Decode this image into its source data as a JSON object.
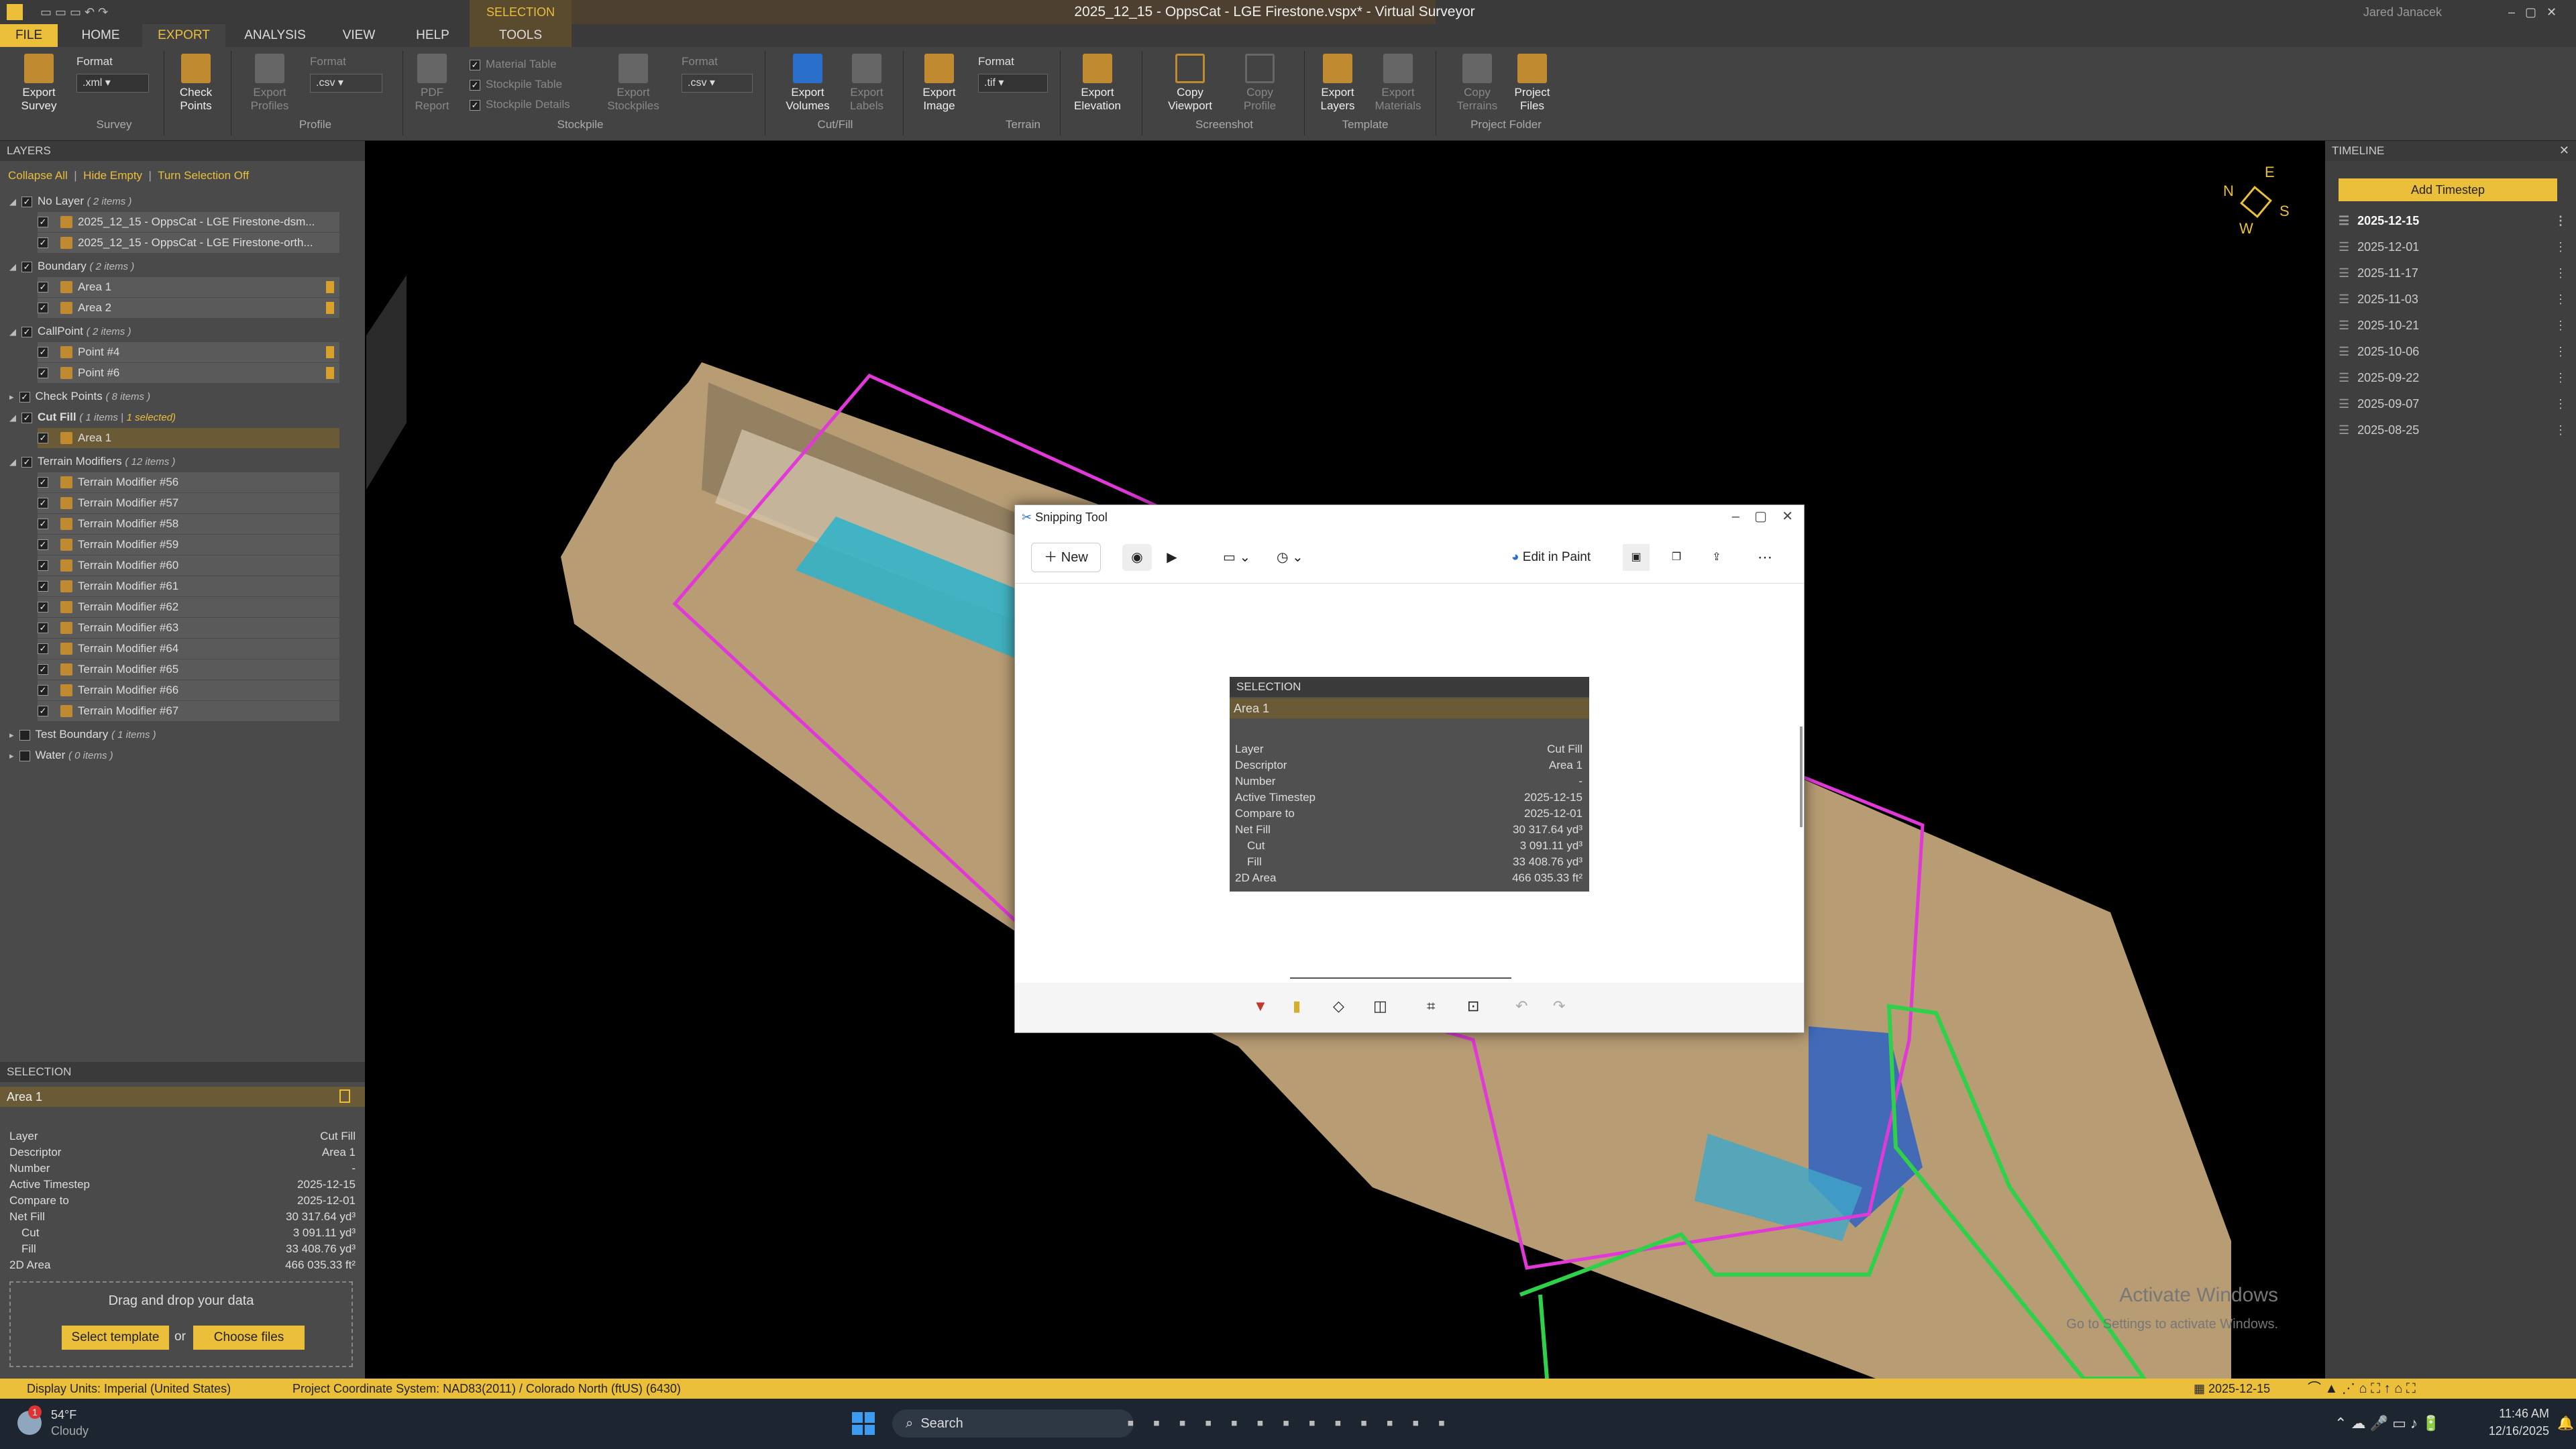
{
  "app": {
    "title": "2025_12_15 - OppsCat - LGE Firestone.vspx* - Virtual Surveyor",
    "user": "Jared Janacek",
    "context_tab_group": "SELECTION"
  },
  "tabs": [
    "FILE",
    "HOME",
    "EXPORT",
    "ANALYSIS",
    "VIEW",
    "HELP",
    "TOOLS"
  ],
  "ribbon": {
    "survey": {
      "export_survey": "Export\nSurvey",
      "format_label": "Format",
      "format_value": ".xml",
      "group": "Survey"
    },
    "check_points": "Check\nPoints",
    "profile": {
      "export_profiles": "Export\nProfiles",
      "format_label": "Format",
      "format_value": ".csv",
      "group": "Profile"
    },
    "stockpile": {
      "pdf_report": "PDF\nReport",
      "material_table": "Material Table",
      "stockpile_table": "Stockpile Table",
      "stockpile_details": "Stockpile Details",
      "export_stockpiles": "Export\nStockpiles",
      "format_label": "Format",
      "format_value": ".csv",
      "group": "Stockpile"
    },
    "cutfill": {
      "export_volumes": "Export\nVolumes",
      "export_labels": "Export\nLabels",
      "group": "Cut/Fill"
    },
    "terrain": {
      "export_image": "Export\nImage",
      "format_label": "Format",
      "format_value": ".tif",
      "export_elevation": "Export\nElevation",
      "group": "Terrain"
    },
    "screenshot": {
      "copy_viewport": "Copy\nViewport",
      "copy_profile": "Copy\nProfile",
      "group": "Screenshot"
    },
    "template": {
      "export_layers": "Export\nLayers",
      "export_materials": "Export\nMaterials",
      "group": "Template"
    },
    "project_folder": {
      "copy_terrains": "Copy\nTerrains",
      "project_files": "Project\nFiles",
      "group": "Project Folder"
    }
  },
  "layers": {
    "header": "LAYERS",
    "actions": [
      "Collapse All",
      "Hide Empty",
      "Turn Selection Off"
    ],
    "groups": [
      {
        "name": "No Layer",
        "count": "( 2 items )",
        "items": [
          "2025_12_15 - OppsCat - LGE Firestone-dsm...",
          "2025_12_15 - OppsCat - LGE Firestone-orth..."
        ]
      },
      {
        "name": "Boundary",
        "count": "( 2 items )",
        "items": [
          "Area 1",
          "Area 2"
        ]
      },
      {
        "name": "CallPoint",
        "count": "( 2 items )",
        "items": [
          "Point #4",
          "Point #6"
        ]
      },
      {
        "name": "Check Points",
        "count": "( 8 items )",
        "items": []
      },
      {
        "name": "Cut Fill",
        "count": "( 1 items |",
        "extra": "1 selected)",
        "items": [
          "Area 1"
        ]
      },
      {
        "name": "Terrain Modifiers",
        "count": "( 12 items )",
        "items": [
          "Terrain Modifier #56",
          "Terrain Modifier #57",
          "Terrain Modifier #58",
          "Terrain Modifier #59",
          "Terrain Modifier #60",
          "Terrain Modifier #61",
          "Terrain Modifier #62",
          "Terrain Modifier #63",
          "Terrain Modifier #64",
          "Terrain Modifier #65",
          "Terrain Modifier #66",
          "Terrain Modifier #67"
        ]
      },
      {
        "name": "Test Boundary",
        "count": "( 1 items )",
        "items": []
      },
      {
        "name": "Water",
        "count": "( 0 items )",
        "items": []
      }
    ]
  },
  "selection": {
    "header": "SELECTION",
    "title": "Area 1",
    "rows": [
      [
        "Layer",
        "Cut Fill"
      ],
      [
        "Descriptor",
        "Area 1"
      ],
      [
        "Number",
        "-"
      ],
      [
        "Active Timestep",
        "2025-12-15"
      ],
      [
        "Compare to",
        "2025-12-01"
      ],
      [
        "Net Fill",
        "30 317.64 yd³"
      ],
      [
        "Cut",
        "3 091.11 yd³"
      ],
      [
        "Fill",
        "33 408.76 yd³"
      ],
      [
        "2D Area",
        "466 035.33 ft²"
      ]
    ]
  },
  "dropzone": {
    "text": "Drag and drop your data",
    "select_template": "Select template",
    "or": "or",
    "choose_files": "Choose files"
  },
  "compass": {
    "n": "N",
    "e": "E",
    "s": "S",
    "w": "W"
  },
  "timeline": {
    "header": "TIMELINE",
    "add": "Add Timestep",
    "steps": [
      "2025-12-15",
      "2025-12-01",
      "2025-11-17",
      "2025-11-03",
      "2025-10-21",
      "2025-10-06",
      "2025-09-22",
      "2025-09-07",
      "2025-08-25"
    ]
  },
  "snipping": {
    "title": "Snipping Tool",
    "new": "New",
    "edit_in_paint": "Edit in Paint"
  },
  "watermark": {
    "line1": "Activate Windows",
    "line2": "Go to Settings to activate Windows."
  },
  "status": {
    "display_units": "Display Units:  Imperial (United States)",
    "crs": "Project Coordinate System:  NAD83(2011) / Colorado North (ftUS) (6430)",
    "date": "2025-12-15"
  },
  "taskbar": {
    "temp": "54°F",
    "weather": "Cloudy",
    "search": "Search",
    "time": "11:46 AM",
    "date": "12/16/2025",
    "badge": "1"
  },
  "colors": {
    "accent": "#ebbf3a",
    "panel": "#4a4a4a",
    "ribbon": "#434343"
  }
}
